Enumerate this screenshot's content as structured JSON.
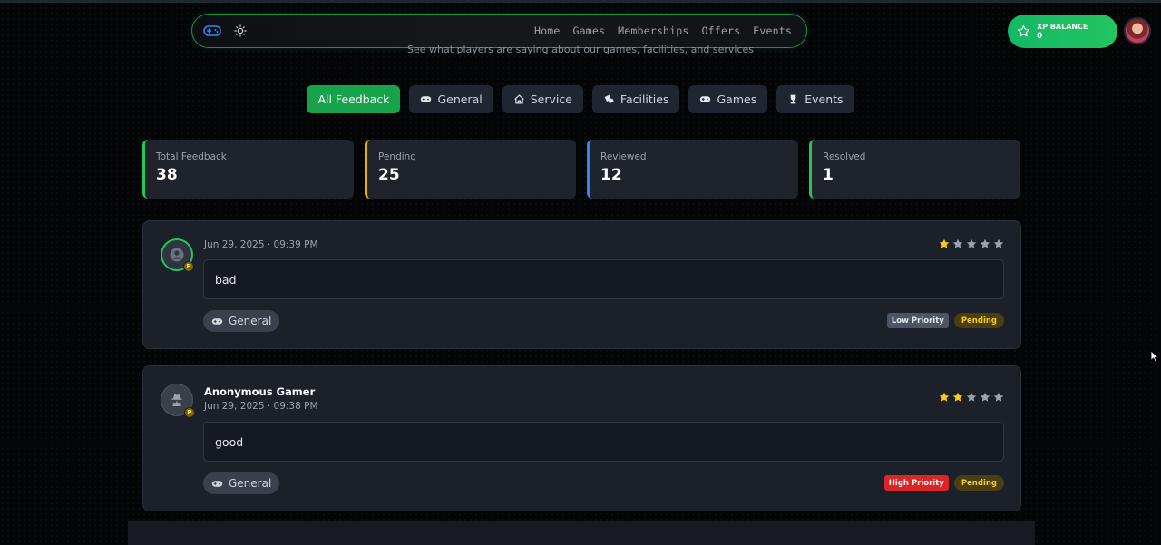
{
  "page": {
    "subtitle": "See what players are saying about our games, facilities, and services"
  },
  "nav": {
    "logo_icon": "gamepad-icon",
    "theme_icon": "sun-icon",
    "links": [
      "Home",
      "Games",
      "Memberships",
      "Offers",
      "Events"
    ]
  },
  "xp": {
    "label": "XP BALANCE",
    "value": "0"
  },
  "filters": [
    {
      "label": "All Feedback",
      "icon": "",
      "active": true
    },
    {
      "label": "General",
      "icon": "gamepad-icon",
      "active": false
    },
    {
      "label": "Service",
      "icon": "home-icon",
      "active": false
    },
    {
      "label": "Facilities",
      "icon": "tickets-icon",
      "active": false
    },
    {
      "label": "Games",
      "icon": "gamepad-icon",
      "active": false
    },
    {
      "label": "Events",
      "icon": "trophy-icon",
      "active": false
    }
  ],
  "stats": [
    {
      "label": "Total Feedback",
      "value": "38"
    },
    {
      "label": "Pending",
      "value": "25"
    },
    {
      "label": "Reviewed",
      "value": "12"
    },
    {
      "label": "Resolved",
      "value": "1"
    }
  ],
  "feedback": [
    {
      "name": "",
      "date": "Jun 29, 2025 · 09:39 PM",
      "rating": 1,
      "message": "bad",
      "category": "General",
      "priority": "Low Priority",
      "status": "Pending",
      "badge": "P"
    },
    {
      "name": "Anonymous Gamer",
      "date": "Jun 29, 2025 · 09:38 PM",
      "rating": 2,
      "message": "good",
      "category": "General",
      "priority": "High Priority",
      "status": "Pending",
      "badge": "P"
    }
  ],
  "colors": {
    "accent": "#22c55e",
    "star_filled": "#facc15",
    "star_empty": "#9ca3af",
    "pending_border": "#eab308",
    "reviewed_border": "#3b82f6"
  }
}
